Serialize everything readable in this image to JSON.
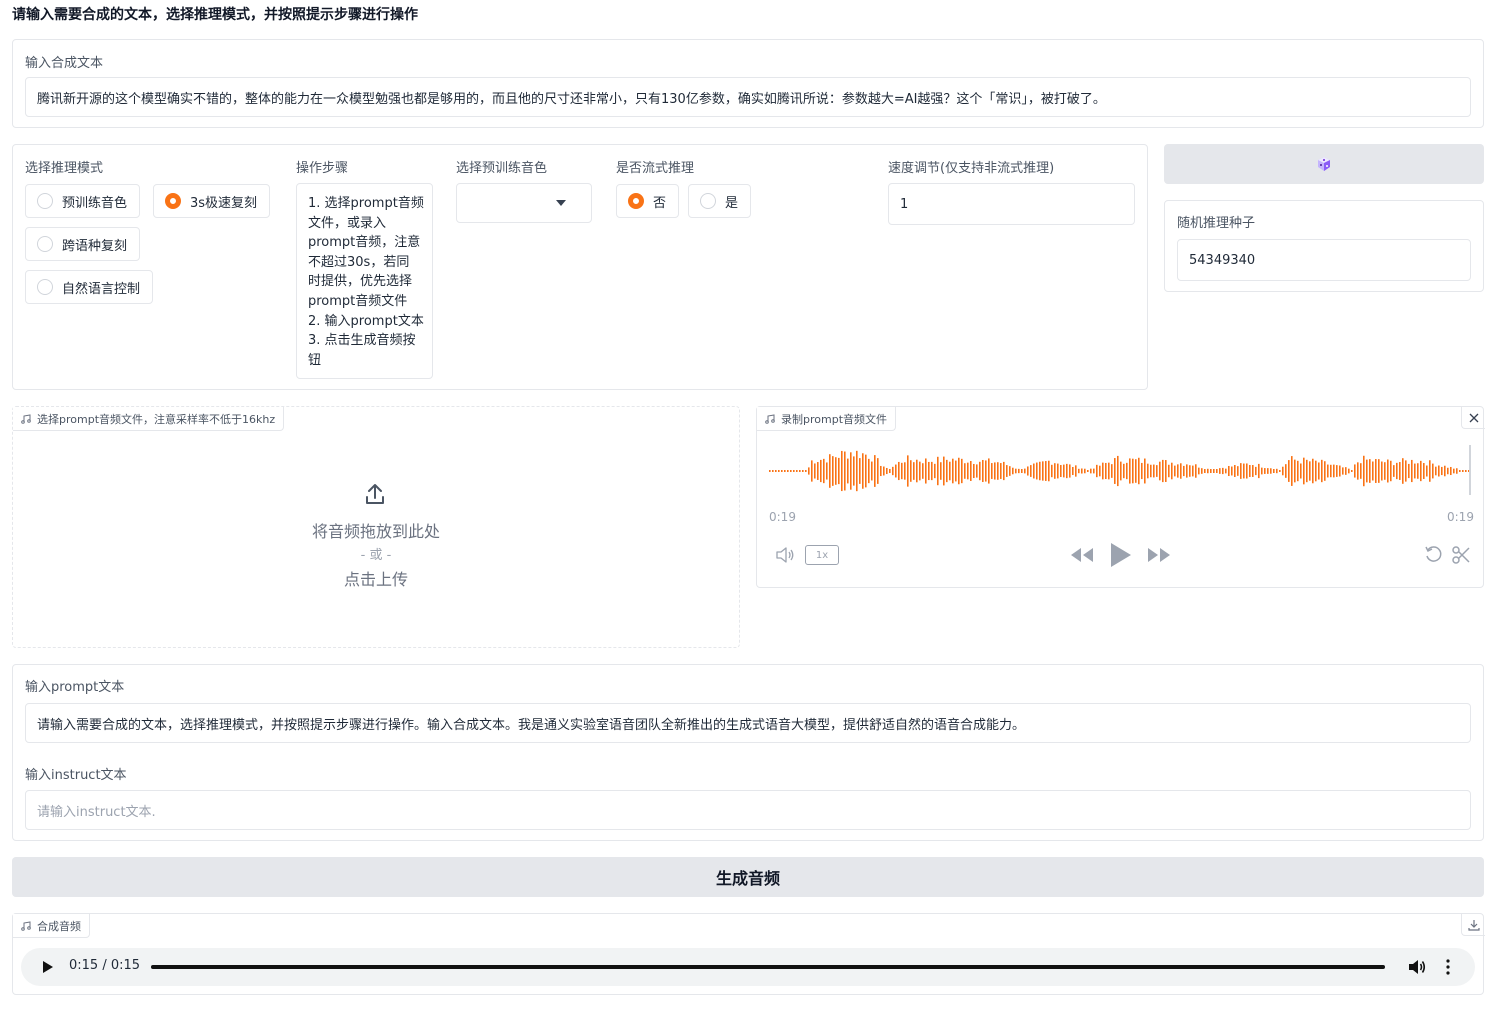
{
  "heading": "请输入需要合成的文本，选择推理模式，并按照提示步骤进行操作",
  "tts_text": {
    "label": "输入合成文本",
    "value": "腾讯新开源的这个模型确实不错的，整体的能力在一众模型勉强也都是够用的，而且他的尺寸还非常小，只有130亿参数，确实如腾讯所说：参数越大=AI越强？这个「常识」，被打破了。"
  },
  "mode": {
    "label": "选择推理模式",
    "options": [
      "预训练音色",
      "3s极速复刻",
      "跨语种复刻",
      "自然语言控制"
    ],
    "selected": "3s极速复刻"
  },
  "steps": {
    "label": "操作步骤",
    "lines": [
      "1. 选择prompt音频",
      "文件，或录入",
      "prompt音频，注意",
      "不超过30s，若同",
      "时提供，优先选择",
      "prompt音频文件",
      "2. 输入prompt文本",
      "3. 点击生成音频按",
      "钮"
    ]
  },
  "speaker": {
    "label": "选择预训练音色",
    "value": ""
  },
  "stream": {
    "label": "是否流式推理",
    "options": [
      "否",
      "是"
    ],
    "selected": "否"
  },
  "speed": {
    "label": "速度调节(仅支持非流式推理)",
    "value": "1"
  },
  "seed": {
    "dice_icon": "dice-icon",
    "label": "随机推理种子",
    "value": "54349340"
  },
  "upload": {
    "label": "选择prompt音频文件，注意采样率不低于16khz",
    "drop_text": "将音频拖放到此处",
    "or_text": "- 或 -",
    "click_text": "点击上传"
  },
  "record": {
    "label": "录制prompt音频文件",
    "time_current": "0:19",
    "time_total": "0:19",
    "speed": "1x",
    "waveform_color": "#f97316"
  },
  "prompt": {
    "label": "输入prompt文本",
    "value": "请输入需要合成的文本，选择推理模式，并按照提示步骤进行操作。输入合成文本。我是通义实验室语音团队全新推出的生成式语音大模型，提供舒适自然的语音合成能力。"
  },
  "instruct": {
    "label": "输入instruct文本",
    "placeholder": "请输入instruct文本."
  },
  "generate": {
    "label": "生成音频"
  },
  "output": {
    "label": "合成音频",
    "time": "0:15 / 0:15",
    "progress": 1.0
  }
}
